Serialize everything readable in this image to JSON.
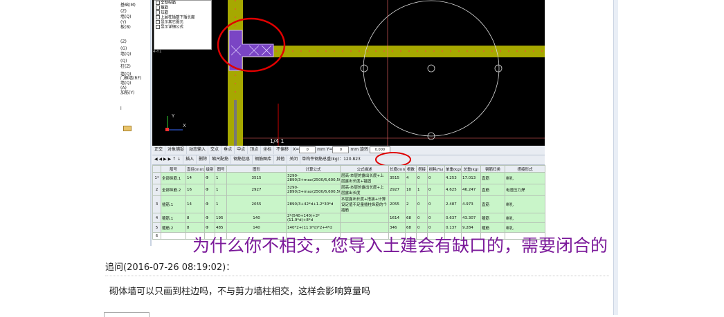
{
  "left_tree": {
    "items": [
      "基础(M)",
      "(Z)",
      "墙(Q)",
      "(Y)",
      "板(B)",
      "(Z)",
      "(G)",
      "墙(Q)",
      "(Q)",
      "柱(Z)",
      "墙(Q)",
      "门框墙(RF)",
      "墙(Q)",
      "(A)",
      "加筋(Y)",
      "l"
    ]
  },
  "legend": {
    "rows": [
      "全部纵筋",
      "箍筋",
      "拉筋",
      "上层柱插筋下插长度",
      "显示其它图元",
      "显示详细公式"
    ]
  },
  "cad": {
    "page_indicator": "1/4 1",
    "left_label": "4-Y1",
    "axis_x": "X",
    "axis_y": "Y"
  },
  "toolbar1": {
    "buttons": [
      "正交",
      "对象捕捉",
      "动态输入",
      "交点",
      "垂点",
      "中点",
      "顶点",
      "坐标",
      "不偏移"
    ],
    "x_label": "X=",
    "x_value": "0",
    "unit1": "mm",
    "y_label": "Y=",
    "y_value": "0",
    "unit2": "mm",
    "rotate_label": "旋转",
    "rotate_value": "0.000"
  },
  "toolbar2": {
    "buttons": [
      "插入",
      "删除",
      "缩尺配筋",
      "钢筋信息",
      "钢筋图库",
      "其他",
      "关闭"
    ],
    "weight_label": "单构件钢筋总重(kg)：",
    "weight_value": "120.823"
  },
  "grid": {
    "headers": [
      "",
      "筋号",
      "直径(mm)",
      "级别",
      "图号",
      "图形",
      "计算公式",
      "公式描述",
      "长度(mm)",
      "根数",
      "搭接",
      "损耗(%)",
      "单重(kg)",
      "总重(kg)",
      "钢筋归类",
      "搭接形式"
    ],
    "rows": [
      {
        "rn": "1*",
        "name": "全部纵筋.1",
        "dia": "14",
        "grade": "Φ",
        "fig": "1",
        "shape": "3515",
        "formula": "3290-2890/3+max(2500/6,600,500)+42*14",
        "desc": "层高-本层的露出长度+上层露出长度+锚固",
        "len": "3515",
        "count": "4",
        "lap": "0",
        "loss": "0",
        "unit_w": "4.253",
        "total_w": "17.013",
        "cat": "直筋",
        "lap_type": "绑扎"
      },
      {
        "rn": "2",
        "name": "全部纵筋.2",
        "dia": "16",
        "grade": "Φ",
        "fig": "1",
        "shape": "2927",
        "formula": "3290-2890/3+max(2500/6,600,500)",
        "desc": "层高-本层的露出长度+上层露出长度",
        "len": "2927",
        "count": "10",
        "lap": "1",
        "loss": "0",
        "unit_w": "4.625",
        "total_w": "46.247",
        "cat": "直筋",
        "lap_type": "电渣压力焊"
      },
      {
        "rn": "3",
        "name": "插筋.1",
        "dia": "14",
        "grade": "Φ",
        "fig": "1",
        "shape": "2055",
        "formula": "2890/3+42*d+1.2*30*d",
        "desc": "本层露出长度+搭接+计算设定值不足量插柱纵筋的个插筋",
        "len": "2055",
        "count": "2",
        "lap": "0",
        "loss": "0",
        "unit_w": "2.487",
        "total_w": "4.973",
        "cat": "直筋",
        "lap_type": "绑扎"
      },
      {
        "rn": "4",
        "name": "箍筋.1",
        "dia": "8",
        "grade": "Φ",
        "fig": "195",
        "shape": "140",
        "formula": "2*(540+140)+2*(11.9*d)+8*d",
        "desc": "",
        "len": "1614",
        "count": "68",
        "lap": "0",
        "loss": "0",
        "unit_w": "0.637",
        "total_w": "43.307",
        "cat": "箍筋",
        "lap_type": "绑扎"
      },
      {
        "rn": "5",
        "name": "箍筋.2",
        "dia": "8",
        "grade": "Φ",
        "fig": "485",
        "shape": "140",
        "formula": "140*2+(11.9*d)*2+4*d",
        "desc": "",
        "len": "346",
        "count": "68",
        "lap": "0",
        "loss": "0",
        "unit_w": "0.137",
        "total_w": "9.284",
        "cat": "箍筋",
        "lap_type": "绑扎"
      }
    ],
    "empty_row": "6"
  },
  "annotation": "为什么你不相交，您导入土建会有缺口的，需要闭合的",
  "followup": "追问(2016-07-26 08:19:02)：",
  "question": "砌体墙可以只画到柱边吗，不与剪力墙柱相交，这样会影响算量吗",
  "colors": {
    "wall": "#a6a800",
    "column": "#7a45c4",
    "highlight": "#e00000",
    "grid_row": "#c9f5c9",
    "annotation": "#7b1a9a"
  }
}
